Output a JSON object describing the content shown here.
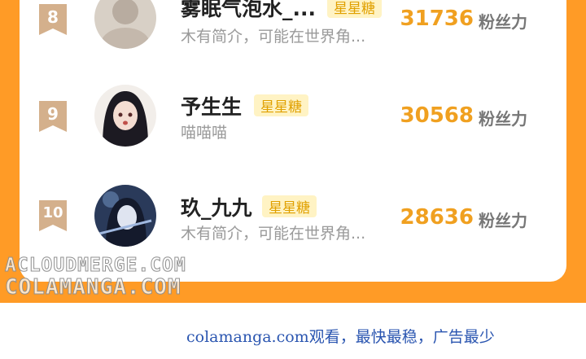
{
  "rows": [
    {
      "rank": "8",
      "name": "雾眠气泡水_...",
      "badge": "星星糖",
      "bio": "木有简介，可能在世界角...",
      "count": "31736",
      "unit": "粉丝力"
    },
    {
      "rank": "9",
      "name": "予生生",
      "badge": "星星糖",
      "bio": "喵喵喵",
      "count": "30568",
      "unit": "粉丝力"
    },
    {
      "rank": "10",
      "name": "玖_九九",
      "badge": "星星糖",
      "bio": "木有简介，可能在世界角...",
      "count": "28636",
      "unit": "粉丝力"
    }
  ],
  "watermark": {
    "line1": "ACLOUDMERGE.COM",
    "line2": "COLAMANGA.COM"
  },
  "footer": {
    "text": "colamanga.com观看，最快最稳，广告最少"
  },
  "colors": {
    "frame": "#ff9b26",
    "count": "#f0a020",
    "badge_text": "#e0a000",
    "badge_bg": "#fff3c4",
    "rank": "#d4b08c",
    "footer": "#2a55b0"
  }
}
